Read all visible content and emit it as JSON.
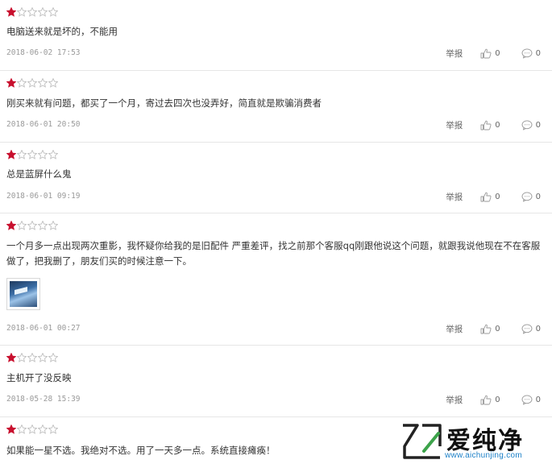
{
  "colors": {
    "star_filled": "#c8102e",
    "star_empty": "#bfbfbf",
    "divider": "#e6e6e6",
    "watermark_url": "#1a7fc7"
  },
  "report_label": "举报",
  "reviews": [
    {
      "rating": 1,
      "text": "电脑送来就是坏的，不能用",
      "date": "2018-06-02 17:53",
      "likes": "0",
      "comments": "0"
    },
    {
      "rating": 1,
      "text": "刚买来就有问题，都买了一个月，寄过去四次也没弄好，简直就是欺骗消费者",
      "date": "2018-06-01 20:50",
      "likes": "0",
      "comments": "0"
    },
    {
      "rating": 1,
      "text": "总是蓝屏什么鬼",
      "date": "2018-06-01 09:19",
      "likes": "0",
      "comments": "0"
    },
    {
      "rating": 1,
      "text": "一个月多一点出现两次重影，我怀疑你给我的是旧配件 严重差评，找之前那个客服qq刚跟他说这个问题，就跟我说他现在不在客服做了，把我删了，朋友们买的时候注意一下。",
      "date": "2018-06-01 00:27",
      "likes": "0",
      "comments": "0",
      "has_image": true
    },
    {
      "rating": 1,
      "text": "主机开了没反映",
      "date": "2018-05-28 15:39",
      "likes": "0",
      "comments": "0"
    },
    {
      "rating": 1,
      "text": "如果能一星不选。我绝对不选。用了一天多一点。系统直接瘫痪！",
      "date": "",
      "likes": "",
      "comments": ""
    }
  ],
  "watermark": {
    "text": "爱纯净",
    "url": "www.aichunjing.com"
  }
}
